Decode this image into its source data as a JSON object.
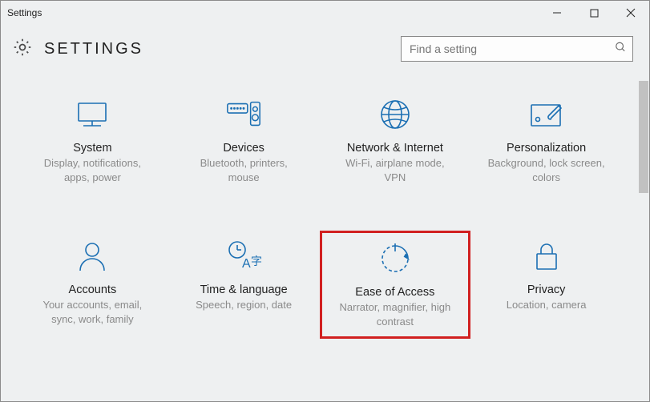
{
  "window": {
    "title": "Settings"
  },
  "header": {
    "title": "SETTINGS"
  },
  "search": {
    "placeholder": "Find a setting"
  },
  "tiles": [
    {
      "id": "system",
      "label": "System",
      "desc": "Display, notifications, apps, power",
      "highlight": false
    },
    {
      "id": "devices",
      "label": "Devices",
      "desc": "Bluetooth, printers, mouse",
      "highlight": false
    },
    {
      "id": "network",
      "label": "Network & Internet",
      "desc": "Wi-Fi, airplane mode, VPN",
      "highlight": false
    },
    {
      "id": "personalization",
      "label": "Personalization",
      "desc": "Background, lock screen, colors",
      "highlight": false
    },
    {
      "id": "accounts",
      "label": "Accounts",
      "desc": "Your accounts, email, sync, work, family",
      "highlight": false
    },
    {
      "id": "time-language",
      "label": "Time & language",
      "desc": "Speech, region, date",
      "highlight": false
    },
    {
      "id": "ease-of-access",
      "label": "Ease of Access",
      "desc": "Narrator, magnifier, high contrast",
      "highlight": true
    },
    {
      "id": "privacy",
      "label": "Privacy",
      "desc": "Location, camera",
      "highlight": false
    }
  ],
  "colors": {
    "accent": "#1b6fb3",
    "highlight": "#d12020"
  }
}
